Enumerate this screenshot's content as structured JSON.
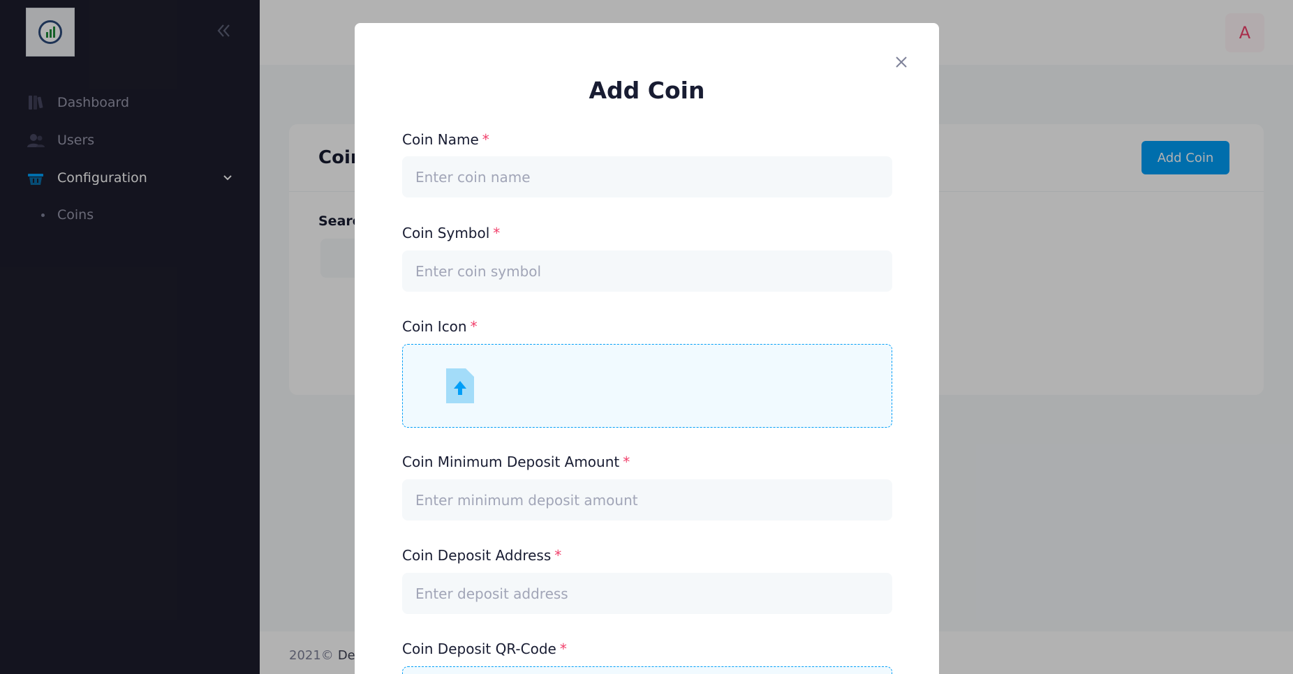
{
  "sidebar": {
    "items": [
      {
        "label": "Dashboard",
        "icon": "dashboard-icon"
      },
      {
        "label": "Users",
        "icon": "users-icon"
      },
      {
        "label": "Configuration",
        "icon": "basket-icon"
      }
    ],
    "sub_items": [
      {
        "label": "Coins"
      }
    ]
  },
  "header": {
    "avatar_initial": "A"
  },
  "page": {
    "card_title": "Coin",
    "add_coin_label": "Add Coin",
    "search_label": "Searc"
  },
  "footer": {
    "year": "2021©",
    "brand": "Dee"
  },
  "modal": {
    "title": "Add Coin",
    "required_mark": "*",
    "fields": {
      "coin_name": {
        "label": "Coin Name",
        "placeholder": "Enter coin name"
      },
      "coin_symbol": {
        "label": "Coin Symbol",
        "placeholder": "Enter coin symbol"
      },
      "coin_icon": {
        "label": "Coin Icon"
      },
      "min_deposit": {
        "label": "Coin Minimum Deposit Amount",
        "placeholder": "Enter minimum deposit amount"
      },
      "deposit_address": {
        "label": "Coin Deposit Address",
        "placeholder": "Enter deposit address"
      },
      "deposit_qr": {
        "label": "Coin Deposit QR-Code"
      }
    }
  },
  "colors": {
    "sidebar_bg": "#1e1e2d",
    "primary": "#009ef7",
    "danger": "#f1416c",
    "input_bg": "#f5f8fa",
    "dropzone_bg": "#f1faff"
  }
}
